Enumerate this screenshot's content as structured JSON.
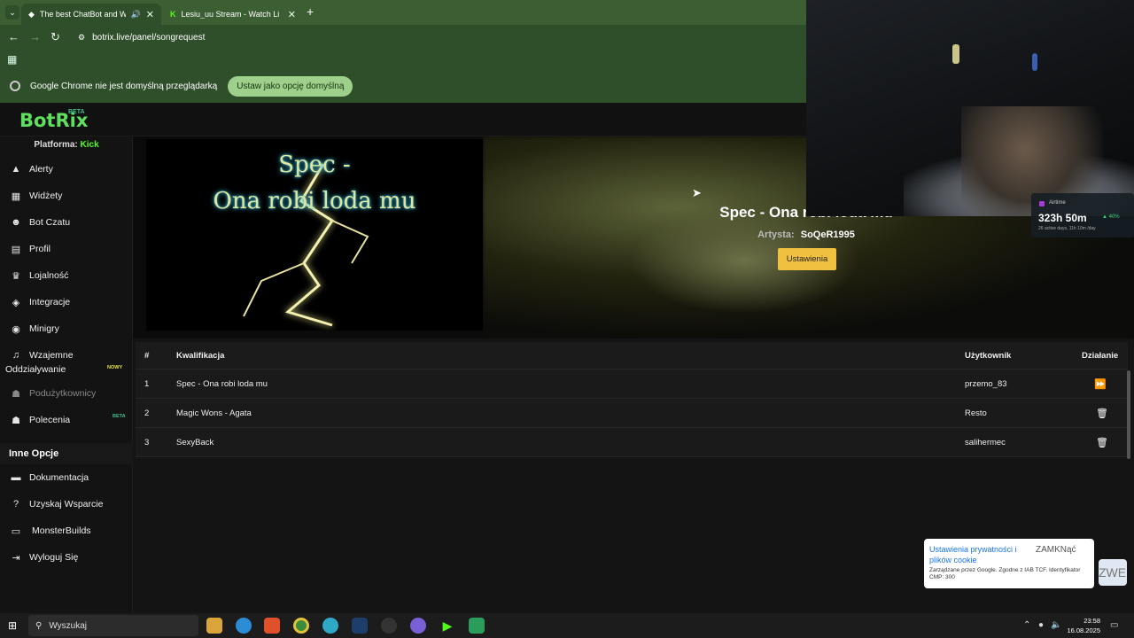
{
  "browser": {
    "tabs": [
      {
        "label": "The best ChatBot and Wid..."
      },
      {
        "label": "Lesiu_uu Stream - Watch Live o..."
      }
    ],
    "url": "botrix.live/panel/songrequest",
    "info_text": "Google Chrome nie jest domyślną przeglądarką",
    "default_button": "Ustaw jako opcję domyślną"
  },
  "app": {
    "logo": "BotRix",
    "logo_badge": "BETA",
    "platform_label": "Platforma:",
    "platform_value": "Kick"
  },
  "sidebar": {
    "items": [
      {
        "label": "Alerty",
        "icon": "alert-triangle-icon"
      },
      {
        "label": "Widżety",
        "icon": "grid-icon"
      },
      {
        "label": "Bot Czatu",
        "icon": "robot-icon"
      },
      {
        "label": "Profil",
        "icon": "profile-card-icon"
      },
      {
        "label": "Lojalność",
        "icon": "trophy-icon"
      },
      {
        "label": "Integracje",
        "icon": "cube-icon"
      },
      {
        "label": "Minigry",
        "icon": "gamepad-icon"
      },
      {
        "label": "Wzajemne",
        "icon": "music-icon"
      },
      {
        "label": "Oddziaływanie"
      },
      {
        "label": "Podużytkownicy",
        "icon": "users-icon"
      },
      {
        "label": "Polecenia",
        "icon": "users-icon"
      }
    ],
    "badges": {
      "nowy": "NOWY",
      "beta": "BETA"
    },
    "section_title": "Inne Opcje",
    "other": [
      {
        "label": "Dokumentacja",
        "icon": "book-icon"
      },
      {
        "label": "Uzyskaj Wsparcie",
        "icon": "help-icon"
      },
      {
        "label": "MonsterBuilds",
        "icon": "monitor-icon"
      },
      {
        "label": "Wyloguj Się",
        "icon": "logout-icon"
      }
    ]
  },
  "now_playing": {
    "cover_line1": "Spec -",
    "cover_line2": "Ona robi loda mu",
    "title": "Spec - Ona robi loda mu",
    "artist_label": "Artysta:",
    "artist": "SoQeR1995",
    "settings_button": "Ustawienia"
  },
  "queue": {
    "headers": {
      "num": "#",
      "title": "Kwalifikacja",
      "user": "Użytkownik",
      "action": "Działanie"
    },
    "rows": [
      {
        "num": "1",
        "title": "Spec - Ona robi loda mu",
        "user": "przemo_83",
        "action_icon": "skip-forward-icon"
      },
      {
        "num": "2",
        "title": "Magic Wons - Agata",
        "user": "Resto",
        "action_icon": "trash-icon"
      },
      {
        "num": "3",
        "title": "SexyBack",
        "user": "salihermec",
        "action_icon": "trash-icon"
      }
    ]
  },
  "airtime": {
    "label": "Airtime",
    "value": "323h 50m",
    "delta": "▲ 40%",
    "sub": "26 active days, 11h 10m /day"
  },
  "cookie": {
    "title": "Ustawienia prywatności i plików cookie",
    "close": "ZAMKNąć",
    "text": "Zarządzane przez Google. Zgodne z IAB TCF. Identyfikator CMP: 300",
    "badge": "ZWE"
  },
  "taskbar": {
    "search_placeholder": "Wyszukaj",
    "time": "23:58",
    "date": "16.08.2025"
  },
  "colors": {
    "accent": "#53fc18",
    "button": "#f0c040",
    "chrome_green": "#2f4f2a"
  }
}
